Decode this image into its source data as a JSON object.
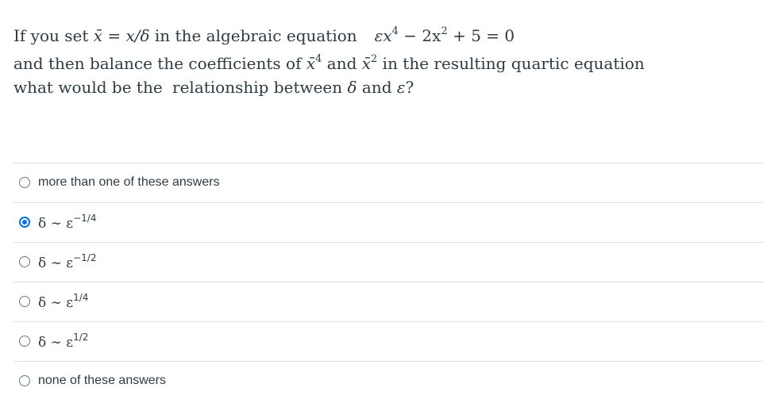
{
  "question": {
    "line1_text": "If you set ",
    "line1_math_set": "x̄ = x/δ",
    "line1_mid": " in the algebraic equation",
    "equation_eps_x": "εx",
    "equation_pow4": "4",
    "equation_minus": " − 2x",
    "equation_pow2": "2",
    "equation_tail": " + 5 = 0",
    "line2_start": "and then balance the coefficients of ",
    "line2_xbar1": "x̄",
    "line2_pow4": "4",
    "line2_and": " and ",
    "line2_xbar2": "x̄",
    "line2_pow2": "2",
    "line2_end": " in the resulting quartic equation",
    "line3_start": "what would be the ",
    "line3_mid": "relationship between ",
    "line3_delta": "δ",
    "line3_and": " and ",
    "line3_eps": "ε",
    "line3_end": "?"
  },
  "answers": [
    {
      "text": "more than one of these answers",
      "selected": false
    },
    {
      "base": "δ ∼ ε",
      "exp": "−1/4",
      "selected": true
    },
    {
      "base": "δ ∼ ε",
      "exp": "−1/2",
      "selected": false
    },
    {
      "base": "δ ∼ ε",
      "exp": "1/4",
      "selected": false
    },
    {
      "base": "δ ∼ ε",
      "exp": "1/2",
      "selected": false
    },
    {
      "text": "none of these answers",
      "selected": false
    }
  ],
  "colors": {
    "text": "#2d3b45",
    "accent": "#0770e0",
    "divider": "#e0e0e0"
  }
}
